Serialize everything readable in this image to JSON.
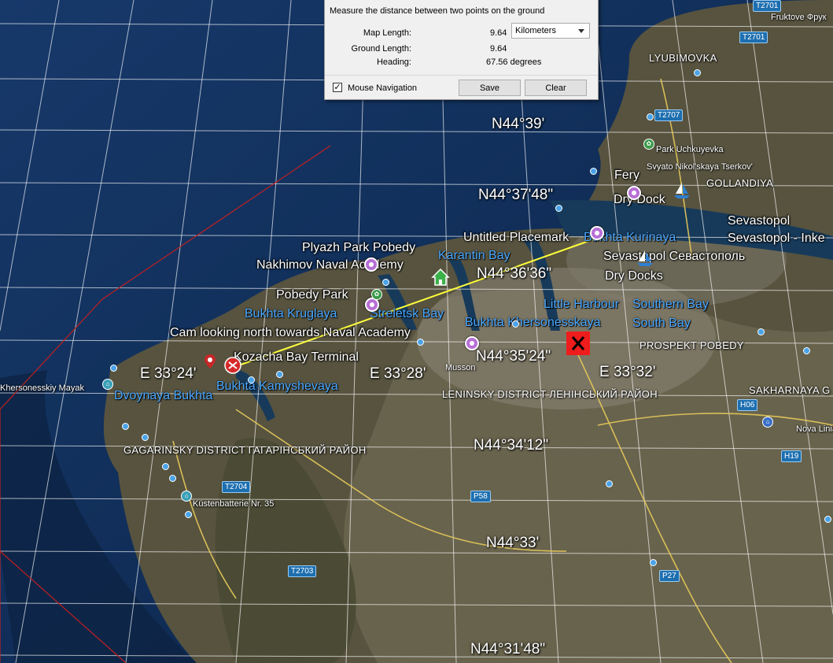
{
  "dialog": {
    "title": "Measure the distance between two points on the ground",
    "map_length_label": "Map Length:",
    "map_length_value": "9.64",
    "unit_selected": "Kilometers",
    "ground_length_label": "Ground Length:",
    "ground_length_value": "9.64",
    "heading_label": "Heading:",
    "heading_value": "67.56 degrees",
    "mouse_nav_label": "Mouse Navigation",
    "mouse_nav_checked": "✓",
    "save_label": "Save",
    "clear_label": "Clear"
  },
  "grid_labels": {
    "n3900": "N44°39'",
    "n3748": "N44°37'48\"",
    "n3636": "N44°36'36\"",
    "n3524": "N44°35'24\"",
    "n3412": "N44°34'12\"",
    "n3300": "N44°33'",
    "n3148": "N44°31'48\"",
    "e3324": "E 33°24'",
    "e3328": "E 33°28'",
    "e3332": "E 33°32'"
  },
  "places": {
    "plyazh": "Plyazh Park Pobedy",
    "nakhimov": "Nakhimov Naval Academy",
    "pobedy_park": "Pobedy Park",
    "cam": "Cam looking north towards Naval Academy",
    "kozacha": "Kozacha Bay Terminal",
    "untitled": "Untitled Placemark",
    "sevastopol_main": "Sevastopol Севастополь",
    "sevastopol1": "Sevastopol",
    "sevastopol2": "Sevastopol - Inke",
    "dry_docks": "Dry Docks",
    "dry_dock": "Dry Dock",
    "fery": "Fery",
    "little_harbour": "Little Harbour",
    "southern_bay": "Southern Bay",
    "south_bay": "South Bay",
    "karantin": "Karantin Bay",
    "kurinaya": "Bukhta Kurinaya",
    "kruglaya": "Bukhta Kruglaya",
    "streletsk": "Streletsk Bay",
    "khersonesskaya": "Bukhta Khersonesskaya",
    "kamysheva": "Bukhta Kamyshevaya",
    "dvoynaya": "Dvoynaya Bukhta",
    "mayak": "Khersonesskiy Mayak",
    "musson": "Musson",
    "leninsky": "LENINSKY DISTRICT ЛЕНІНСЬКИЙ РАЙОН",
    "gagarinsky": "GAGARINSKY DISTRICT ГАГАРІНСЬКИЙ РАЙОН",
    "prospekt": "PROSPEKT POBEDY",
    "sakharnaya": "SAKHARNAYA G",
    "lyubimovka": "LYUBIMOVKA",
    "gollandiya": "GOLLANDIYA",
    "fruktove": "Fruktove Фрук",
    "uchkuyevka": "Park Uchkuyevka",
    "svyato": "Svyato Nikol'skaya Tserkov'",
    "nova_linia": "Nova Linia",
    "kustenbatterie": "Küstenbatterie Nr. 35"
  },
  "roads": {
    "t2701a": "T2701",
    "t2701b": "T2701",
    "t2707": "T2707",
    "h06": "H06",
    "h19": "H19",
    "p58": "P58",
    "p27": "P27",
    "t2704": "T2704",
    "t2703": "T2703"
  },
  "colors": {
    "measure_line": "#ffff3c",
    "region_outline": "#c02020",
    "water_label": "#4aa8ff"
  }
}
